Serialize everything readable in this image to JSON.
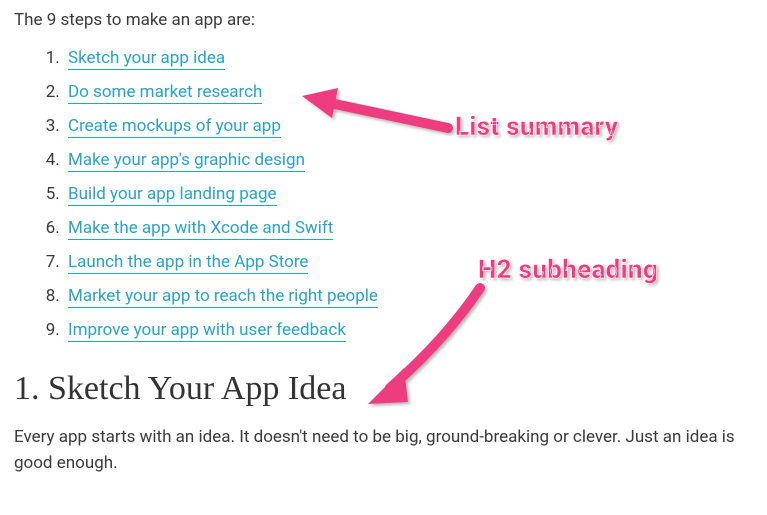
{
  "intro_text": "The 9 steps to make an app are:",
  "steps": [
    "Sketch your app idea",
    "Do some market research",
    "Create mockups of your app",
    "Make your app's graphic design",
    "Build your app landing page",
    "Make the app with Xcode and Swift",
    "Launch the app in the App Store",
    "Market your app to reach the right people",
    "Improve your app with user feedback"
  ],
  "subheading": "1. Sketch Your App Idea",
  "paragraph": "Every app starts with an idea. It doesn't need to be big, ground-breaking or clever. Just an idea is good enough.",
  "annotations": {
    "label1": "List summary",
    "label2": "H2 subheading"
  },
  "colors": {
    "link": "#28a3c5",
    "annotation": "#ee3d7f"
  }
}
